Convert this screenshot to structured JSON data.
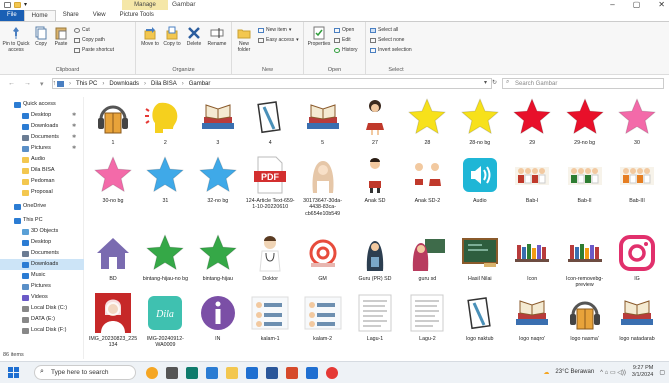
{
  "window": {
    "manage_tab": "Manage",
    "title": "Gambar",
    "min": "–",
    "max": "▢",
    "close": "✕"
  },
  "tabs": [
    "File",
    "Home",
    "Share",
    "View",
    "Picture Tools"
  ],
  "ribbon": {
    "clipboard": {
      "pin": "Pin to Quick access",
      "copy": "Copy",
      "paste": "Paste",
      "cut": "Cut",
      "copy_path": "Copy path",
      "paste_shortcut": "Paste shortcut",
      "name": "Clipboard"
    },
    "organize": {
      "move_to": "Move to",
      "copy_to": "Copy to",
      "delete": "Delete",
      "rename": "Rename",
      "name": "Organize"
    },
    "new": {
      "new_folder": "New folder",
      "new_item": "New item",
      "easy_access": "Easy access",
      "name": "New"
    },
    "open": {
      "properties": "Properties",
      "open": "Open",
      "edit": "Edit",
      "history": "History",
      "name": "Open"
    },
    "select": {
      "select_all": "Select all",
      "select_none": "Select none",
      "invert": "Invert selection",
      "name": "Select"
    }
  },
  "address": {
    "path": [
      "This PC",
      "Downloads",
      "Dila BISA",
      "Gambar"
    ],
    "search_placeholder": "Search Gambar"
  },
  "sidebar": {
    "items": [
      {
        "label": "Quick access",
        "icon": "star-icon"
      },
      {
        "label": "Desktop",
        "icon": "desktop-icon"
      },
      {
        "label": "Downloads",
        "icon": "download-icon"
      },
      {
        "label": "Documents",
        "icon": "document-icon"
      },
      {
        "label": "Pictures",
        "icon": "pictures-icon"
      },
      {
        "label": "Audio",
        "icon": "folder-icon"
      },
      {
        "label": "Dila BISA",
        "icon": "folder-icon"
      },
      {
        "label": "Pedoman",
        "icon": "folder-icon"
      },
      {
        "label": "Proposal",
        "icon": "folder-icon"
      },
      {
        "label": "OneDrive",
        "icon": "cloud-icon"
      },
      {
        "label": "This PC",
        "icon": "pc-icon"
      },
      {
        "label": "3D Objects",
        "icon": "cube-icon"
      },
      {
        "label": "Desktop",
        "icon": "desktop-icon"
      },
      {
        "label": "Documents",
        "icon": "document-icon"
      },
      {
        "label": "Downloads",
        "icon": "download-icon"
      },
      {
        "label": "Music",
        "icon": "music-icon"
      },
      {
        "label": "Pictures",
        "icon": "pictures-icon"
      },
      {
        "label": "Videos",
        "icon": "video-icon"
      },
      {
        "label": "Local Disk (C:)",
        "icon": "drive-icon"
      },
      {
        "label": "DATA (E:)",
        "icon": "drive-icon"
      },
      {
        "label": "Local Disk (F:)",
        "icon": "drive-icon"
      }
    ]
  },
  "files": [
    {
      "name": "1",
      "kind": "book-headphones",
      "color": "#e8a33a"
    },
    {
      "name": "2",
      "kind": "speaking-head",
      "color": "#f5d01e"
    },
    {
      "name": "3",
      "kind": "books",
      "color": "#8a5a2b"
    },
    {
      "name": "4",
      "kind": "notebook",
      "color": "#4a90b8"
    },
    {
      "name": "5",
      "kind": "books",
      "color": "#8a5a2b"
    },
    {
      "name": "27",
      "kind": "girl",
      "color": "#c0392b"
    },
    {
      "name": "28",
      "kind": "star",
      "color": "#f7e11b"
    },
    {
      "name": "28-no bg",
      "kind": "star",
      "color": "#f7e11b"
    },
    {
      "name": "29",
      "kind": "star",
      "color": "#e8102a"
    },
    {
      "name": "29-no bg",
      "kind": "star",
      "color": "#e8102a"
    },
    {
      "name": "30",
      "kind": "star",
      "color": "#f36aa9"
    },
    {
      "name": "30-no bg",
      "kind": "star",
      "color": "#f36aa9"
    },
    {
      "name": "31",
      "kind": "star",
      "color": "#3fa9e8"
    },
    {
      "name": "32-no bg",
      "kind": "star",
      "color": "#3fa9e8"
    },
    {
      "name": "124-Article Text-659-1-10-20220610",
      "kind": "pdf",
      "color": "#d32f2f"
    },
    {
      "name": "30173647-30da-4438-83ca-cb654e10b549",
      "kind": "hijab-girl",
      "color": "#e6c7a8"
    },
    {
      "name": "Anak SD",
      "kind": "boy",
      "color": "#c0392b"
    },
    {
      "name": "Anak SD-2",
      "kind": "kids",
      "color": "#c0392b"
    },
    {
      "name": "Audio",
      "kind": "audio",
      "color": "#1fb6d6"
    },
    {
      "name": "Bab-I",
      "kind": "group",
      "color": "#c0392b"
    },
    {
      "name": "Bab-II",
      "kind": "group",
      "color": "#2e7d32"
    },
    {
      "name": "Bab-III",
      "kind": "group",
      "color": "#e67e22"
    },
    {
      "name": "BD",
      "kind": "house",
      "color": "#7a6bb0"
    },
    {
      "name": "bintang-hijau-no bg",
      "kind": "star",
      "color": "#35a847"
    },
    {
      "name": "bintang-hijau",
      "kind": "star",
      "color": "#35a847"
    },
    {
      "name": "Doktor",
      "kind": "doctor",
      "color": "#f0d4b5"
    },
    {
      "name": "GM",
      "kind": "email",
      "color": "#e74c3c"
    },
    {
      "name": "Guru (PR) SD",
      "kind": "teacher",
      "color": "#2c3e50"
    },
    {
      "name": "guru sd",
      "kind": "teacher-board",
      "color": "#b83b5e"
    },
    {
      "name": "Hasil Nilai",
      "kind": "chalkboard",
      "color": "#2e5e3e"
    },
    {
      "name": "Icon",
      "kind": "bookshelf",
      "color": "#6d4c41"
    },
    {
      "name": "Icon-removebg-preview",
      "kind": "bookshelf",
      "color": "#6d4c41"
    },
    {
      "name": "IG",
      "kind": "instagram",
      "color": "#e1306c"
    },
    {
      "name": "IMG_20230823_225134",
      "kind": "photo",
      "color": "#c62828"
    },
    {
      "name": "IMG-20240912-WA0009",
      "kind": "dila",
      "color": "#3fc1b0"
    },
    {
      "name": "IN",
      "kind": "info",
      "color": "#7b4fa6"
    },
    {
      "name": "kalam-1",
      "kind": "kalam",
      "color": "#6d8fb0"
    },
    {
      "name": "kalam-2",
      "kind": "kalam",
      "color": "#6d8fb0"
    },
    {
      "name": "Lagu-1",
      "kind": "lyrics",
      "color": "#999999"
    },
    {
      "name": "Lagu-2",
      "kind": "lyrics",
      "color": "#999999"
    },
    {
      "name": "logo naktub",
      "kind": "notebook",
      "color": "#4a90b8"
    },
    {
      "name": "logo naqro'",
      "kind": "books",
      "color": "#8a5a2b"
    },
    {
      "name": "logo nasma'",
      "kind": "book-headphones",
      "color": "#e8a33a"
    },
    {
      "name": "logo natadarab",
      "kind": "books",
      "color": "#8a5a2b"
    }
  ],
  "status": {
    "count": "86 items"
  },
  "taskbar": {
    "search_placeholder": "Type here to search",
    "weather": "23°C Berawan",
    "time": "9:27 PM",
    "date": "3/1/2024"
  }
}
